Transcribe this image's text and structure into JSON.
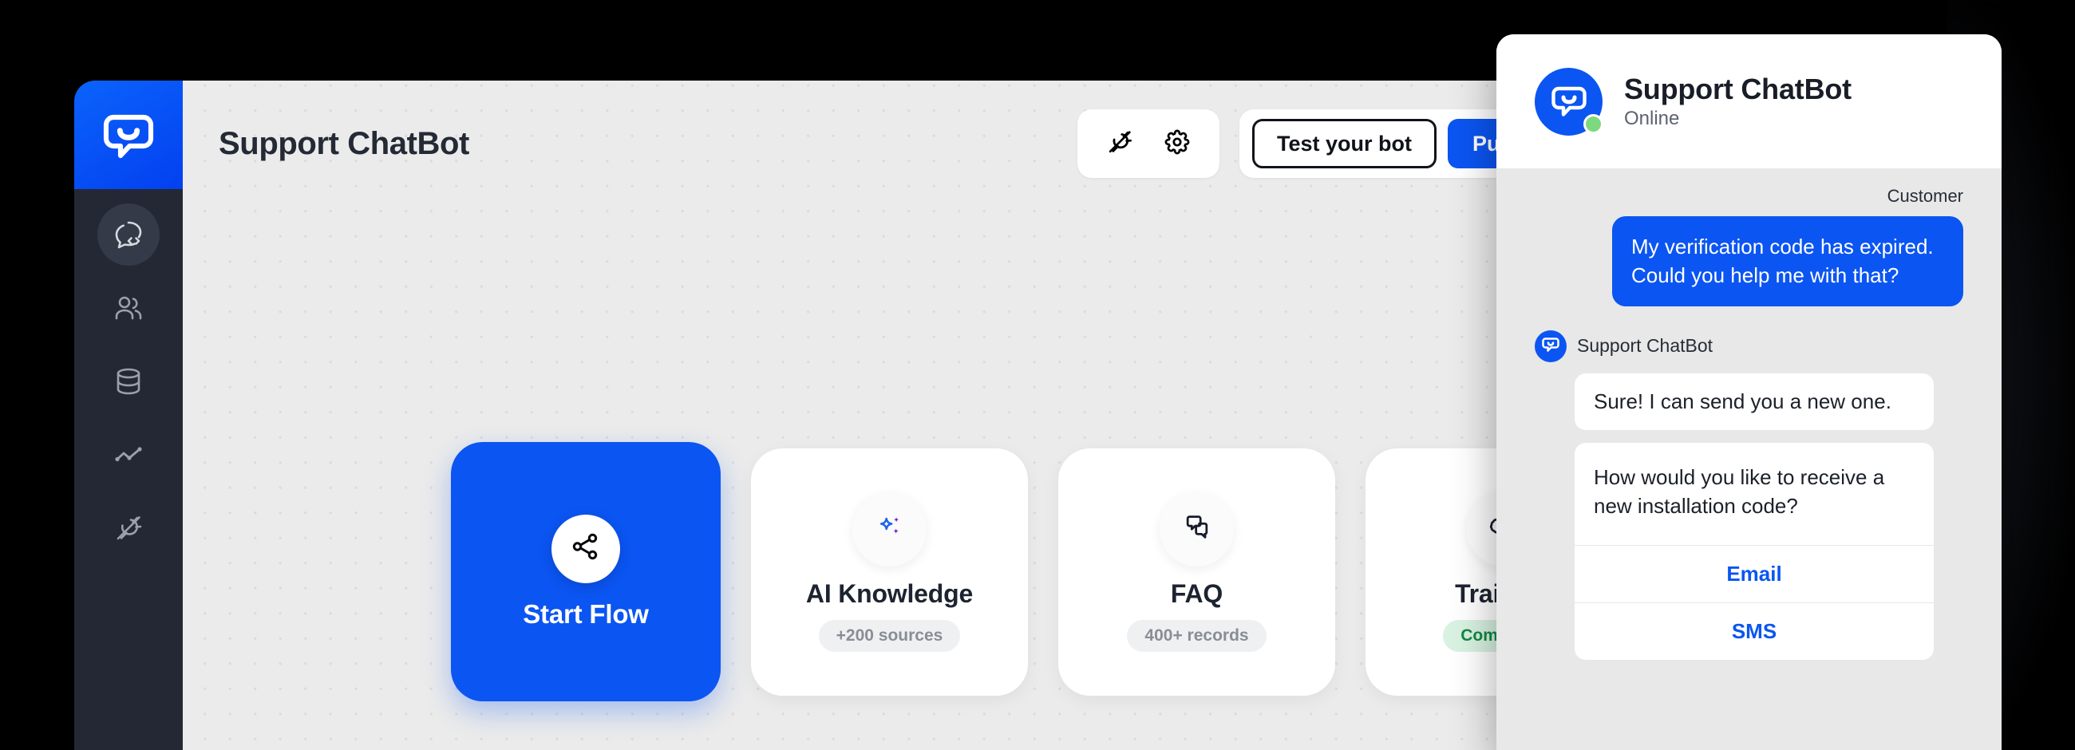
{
  "app": {
    "logo_icon": "chatbot-logo-icon",
    "page_title": "Support ChatBot"
  },
  "sidebar": {
    "items": [
      {
        "icon": "chat-code-icon",
        "name": "chat-with-code",
        "active": true
      },
      {
        "icon": "users-icon",
        "name": "users",
        "active": false
      },
      {
        "icon": "database-icon",
        "name": "database",
        "active": false
      },
      {
        "icon": "analytics-line-icon",
        "name": "analytics",
        "active": false
      },
      {
        "icon": "plug-disconnected-icon",
        "name": "integrations",
        "active": false
      }
    ]
  },
  "toolbar": {
    "plug_icon": "plug-disconnected-icon",
    "settings_icon": "gear-icon",
    "test_bot_label": "Test your bot",
    "publish_label": "Publish"
  },
  "cards": [
    {
      "title": "Start Flow",
      "icon": "share-nodes-icon",
      "badge": "",
      "primary": true,
      "badge_style": "none"
    },
    {
      "title": "AI Knowledge",
      "icon": "sparkles-icon",
      "badge": "+200 sources",
      "primary": false,
      "badge_style": "neutral"
    },
    {
      "title": "FAQ",
      "icon": "speech-bubbles-icon",
      "badge": "400+ records",
      "primary": false,
      "badge_style": "neutral"
    },
    {
      "title": "Training",
      "icon": "brain-icon",
      "badge": "Completed",
      "primary": false,
      "badge_style": "success"
    }
  ],
  "chat_widget": {
    "bot_name": "Support ChatBot",
    "status": "Online",
    "avatar_icon": "chatbot-logo-icon",
    "customer_label": "Customer",
    "customer_message": "My verification code has expired. Could you help me with that?",
    "bot_name_inline": "Support ChatBot",
    "bot_message_1": "Sure! I can send you a new one.",
    "bot_card_text": "How would you like to receive a new installation code?",
    "quick_replies": [
      {
        "label": "Email"
      },
      {
        "label": "SMS"
      }
    ]
  },
  "colors": {
    "brand_blue": "#0b55f2",
    "sidebar_dark": "#232834",
    "canvas_grey": "#ebebeb",
    "success_green": "#0f8a43",
    "online_dot": "#7ed87e",
    "sparkle_purple": "#6f1fe0"
  }
}
